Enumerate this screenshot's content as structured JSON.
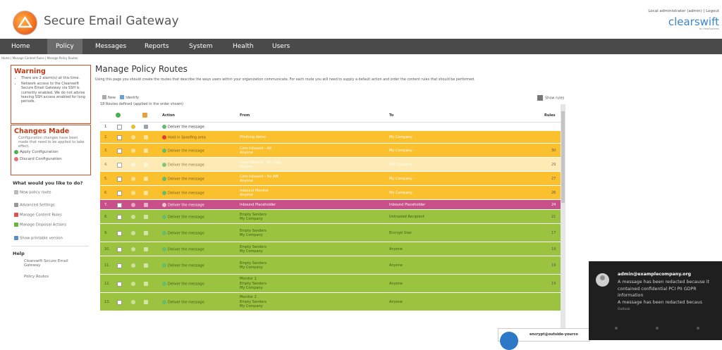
{
  "header": {
    "app_title": "Secure Email Gateway",
    "user_line": "Local administrator (admin) | Logout",
    "brand": "clearswift",
    "brand_sub": "by HelpSystems"
  },
  "nav": [
    "Home",
    "Policy",
    "Messages",
    "Reports",
    "System",
    "Health",
    "Users"
  ],
  "nav_active": "Policy",
  "breadcrumb": "Home | Manage Content Rules | Manage Policy Routes",
  "sidebar": {
    "warning_title": "Warning",
    "warning_items": [
      "There are 2 alarm(s) at this time.",
      "Network access to the Clearswift Secure Email Gateway via SSH is currently enabled. We do not advise leaving SSH access enabled for long periods."
    ],
    "changes_title": "Changes Made",
    "changes_text": "Configuration changes have been made that need to be applied to take effect.",
    "apply_label": "Apply Configuration",
    "discard_label": "Discard Configuration",
    "todo_title": "What would you like to do?",
    "todo_items": [
      "New policy route",
      "Advanced Settings",
      "Manage Content Rules",
      "Manage Disposal Actions",
      "Show printable version"
    ],
    "help_title": "Help",
    "help_items": [
      "Clearswift Secure Email Gateway",
      "Policy Routes"
    ]
  },
  "main": {
    "title": "Manage Policy Routes",
    "description": "Using this page you should create the routes that describe the ways users within your organization communicate. For each route you will need to supply a default action and order the content rules that should be performed.",
    "new_label": "New",
    "identify_label": "Identify",
    "show_rules_label": "Show rules",
    "count_label": "18 Routes defined (applied in the order shown)",
    "columns": {
      "action": "Action",
      "from": "From",
      "to": "To",
      "rules": "Rules"
    }
  },
  "rows": [
    {
      "num": "1.",
      "action": "Deliver the message",
      "from": "",
      "to": "",
      "rules": "",
      "color": "#ffffff"
    },
    {
      "num": "2.",
      "action": "Hold in Spoofing area",
      "from": "Phishing demo",
      "to": "My Company",
      "rules": "",
      "color": "#fbc02d"
    },
    {
      "num": "3.",
      "action": "Deliver the message",
      "from": "Core Inbound - All\nAnyone",
      "to": "My Company",
      "rules": "30",
      "color": "#fbc02d"
    },
    {
      "num": "4.",
      "action": "Deliver the message",
      "from": "Core Inbound - All Copy\nAnyone",
      "to": "My Company",
      "rules": "29",
      "color": "#fde7a8"
    },
    {
      "num": "5.",
      "action": "Deliver the message",
      "from": "Core Inbound - No AM\nAnyone",
      "to": "My Company",
      "rules": "27",
      "color": "#fbc02d"
    },
    {
      "num": "6.",
      "action": "Deliver the message",
      "from": "Inbound Monitor\nAnyone",
      "to": "My Company",
      "rules": "26",
      "color": "#fbc02d"
    },
    {
      "num": "7.",
      "action": "Deliver the message",
      "from": "Inbound Placeholder",
      "to": "Inbound Placeholder",
      "rules": "24",
      "color": "#c94f89"
    },
    {
      "num": "8.",
      "action": "Deliver the message",
      "from": "Empty Senders\nMy Company",
      "to": "Untrusted Recipient",
      "rules": "21",
      "color": "#9bc33f"
    },
    {
      "num": "9.",
      "action": "Deliver the message",
      "from": "Empty Senders\nMy Company",
      "to": "Encrypt User",
      "rules": "17",
      "color": "#9bc33f"
    },
    {
      "num": "10.",
      "action": "Deliver the message",
      "from": "Empty Senders\nMy Company",
      "to": "Anyone",
      "rules": "19",
      "color": "#9bc33f"
    },
    {
      "num": "11.",
      "action": "Deliver the message",
      "from": "Empty Senders\nMy Company",
      "to": "Anyone",
      "rules": "19",
      "color": "#9bc33f"
    },
    {
      "num": "12.",
      "action": "Deliver the message",
      "from": "Monitor 1\nEmpty Senders\nMy Company",
      "to": "Anyone",
      "rules": "19",
      "color": "#9bc33f"
    },
    {
      "num": "13.",
      "action": "Deliver the message",
      "from": "Monitor 2\nEmpty Senders\nMy Company",
      "to": "Anyone",
      "rules": "",
      "color": "#9bc33f"
    }
  ],
  "notification": {
    "sender": "admin@examplecompany.org",
    "message": "A message has been redacted because it contained confidential PCI PII GDPR information\nA message has been redacted becaus",
    "app": "Outlook"
  },
  "mini_notification": {
    "text": "encrypt@outside-yourco"
  }
}
